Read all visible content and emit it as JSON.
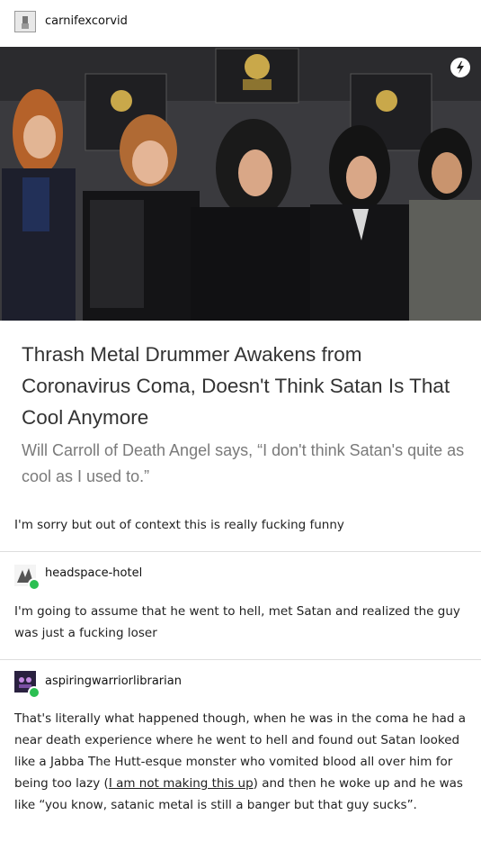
{
  "post": {
    "author": "carnifexcorvid",
    "headline": "Thrash Metal Drummer Awakens from Coronavirus Coma, Doesn't Think Satan Is That Cool Anymore",
    "subtitle": "Will Carroll of Death Angel says, “I don't think Satan's quite as cool as I used to.”",
    "caption": "I'm sorry but out of context this is really fucking funny"
  },
  "reblogs": [
    {
      "username": "headspace-hotel",
      "text": "I'm going to assume that he went to hell, met Satan and realized the guy was just a fucking loser"
    },
    {
      "username": "aspiringwarriorlibrarian",
      "text_before": "That's literally what happened though, when he was in the coma he had a near death experience where he went to hell and found out Satan looked like a Jabba The Hutt-esque monster who vomited blood all over him for being too lazy (",
      "link_text": "I am not making this up",
      "text_after": ") and then he woke up and he was like “you know, satanic metal is still a banger but that guy sucks”."
    }
  ],
  "colors": {
    "badge": "#2bbf52",
    "divider": "#dddddd",
    "subtitle": "#7a7a7a"
  },
  "icons": [
    "lightning-icon",
    "trophy-icon"
  ]
}
